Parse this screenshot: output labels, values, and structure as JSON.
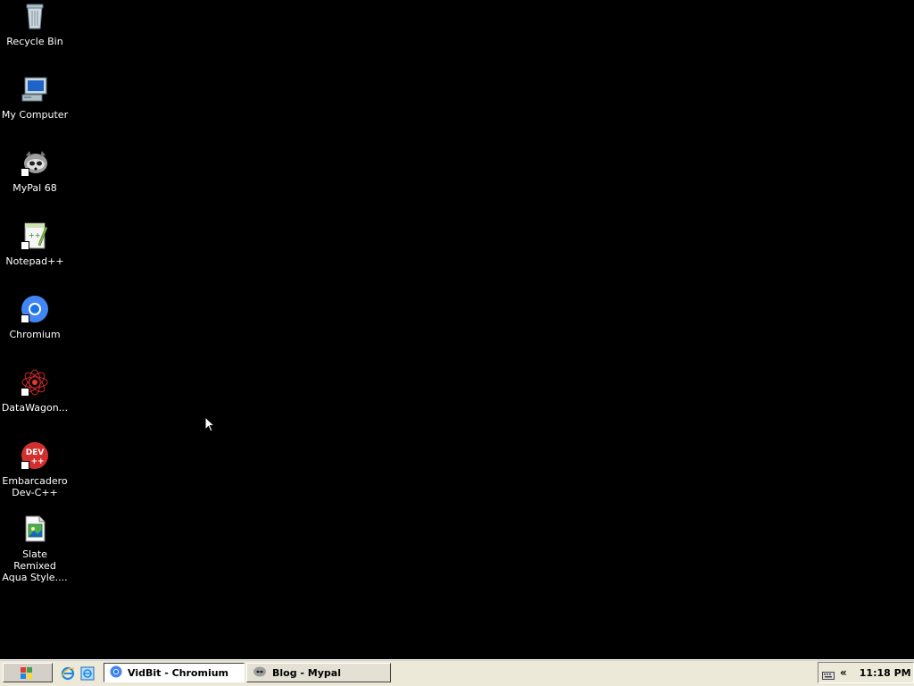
{
  "desktop": {
    "icons": [
      {
        "label": "Recycle Bin",
        "icon": "recycle-bin-icon"
      },
      {
        "label": "My Computer",
        "icon": "my-computer-icon"
      },
      {
        "label": "MyPal 68",
        "icon": "mypal-icon"
      },
      {
        "label": "Notepad++",
        "icon": "notepad-plus-plus-icon"
      },
      {
        "label": "Chromium",
        "icon": "chromium-icon"
      },
      {
        "label": "DataWagon...",
        "icon": "datawagon-icon"
      },
      {
        "label": "Embarcadero\nDev-C++",
        "icon": "dev-cpp-icon"
      },
      {
        "label": "Slate Remixed\nAqua Style....",
        "icon": "image-file-icon"
      }
    ]
  },
  "taskbar": {
    "quick_launch": [
      "internet-explorer-icon",
      "ie-settings-icon"
    ],
    "windows": [
      {
        "label": "VidBit - Chromium",
        "icon": "chromium-icon",
        "active": true
      },
      {
        "label": "Blog - Mypal",
        "icon": "mypal-icon",
        "active": false
      }
    ],
    "tray": {
      "chevron": "«",
      "clock": "11:18 PM"
    }
  },
  "colors": {
    "desktop_bg": "#000000",
    "taskbar_bg": "#ece9d8",
    "chromium_blue": "#1a73e8",
    "devcpp_red": "#d32f2f"
  }
}
